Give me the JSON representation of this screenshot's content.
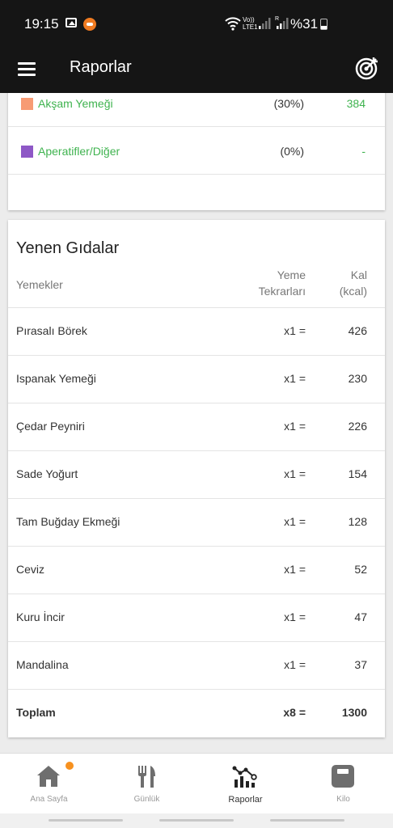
{
  "status_bar": {
    "time": "19:15",
    "lte_top": "Vo))",
    "lte_bottom": "LTE1",
    "roaming": "R",
    "battery": "%31"
  },
  "app_bar": {
    "title": "Raporlar",
    "menu_icon": "hamburger-menu-icon",
    "action_icon": "target-icon"
  },
  "meals": [
    {
      "label": "Akşam Yemeği",
      "percent": "(30%)",
      "kcal": "384",
      "color": "#f79b74"
    },
    {
      "label": "Aperatifler/Diğer",
      "percent": "(0%)",
      "kcal": "-",
      "color": "#8e58c6"
    }
  ],
  "foods_card": {
    "title": "Yenen Gıdalar",
    "columns": {
      "name": "Yemekler",
      "repeat_line1": "Yeme",
      "repeat_line2": "Tekrarları",
      "kcal_line1": "Kal",
      "kcal_line2": "(kcal)"
    },
    "rows": [
      {
        "name": "Pırasalı Börek",
        "qty": "x1 =",
        "kcal": "426"
      },
      {
        "name": "Ispanak Yemeği",
        "qty": "x1 =",
        "kcal": "230"
      },
      {
        "name": "Çedar Peyniri",
        "qty": "x1 =",
        "kcal": "226"
      },
      {
        "name": "Sade Yoğurt",
        "qty": "x1 =",
        "kcal": "154"
      },
      {
        "name": "Tam Buğday Ekmeği",
        "qty": "x1 =",
        "kcal": "128"
      },
      {
        "name": "Ceviz",
        "qty": "x1 =",
        "kcal": "52"
      },
      {
        "name": "Kuru İncir",
        "qty": "x1 =",
        "kcal": "47"
      },
      {
        "name": "Mandalina",
        "qty": "x1 =",
        "kcal": "37"
      }
    ],
    "total": {
      "name": "Toplam",
      "qty": "x8 =",
      "kcal": "1300"
    }
  },
  "bottom_nav": [
    {
      "label": "Ana Sayfa",
      "icon": "home-icon",
      "has_badge": true,
      "badge_color": "#f7911f"
    },
    {
      "label": "Günlük",
      "icon": "fork-knife-icon"
    },
    {
      "label": "Raporlar",
      "icon": "chart-icon",
      "active": true
    },
    {
      "label": "Kilo",
      "icon": "scale-icon"
    }
  ]
}
